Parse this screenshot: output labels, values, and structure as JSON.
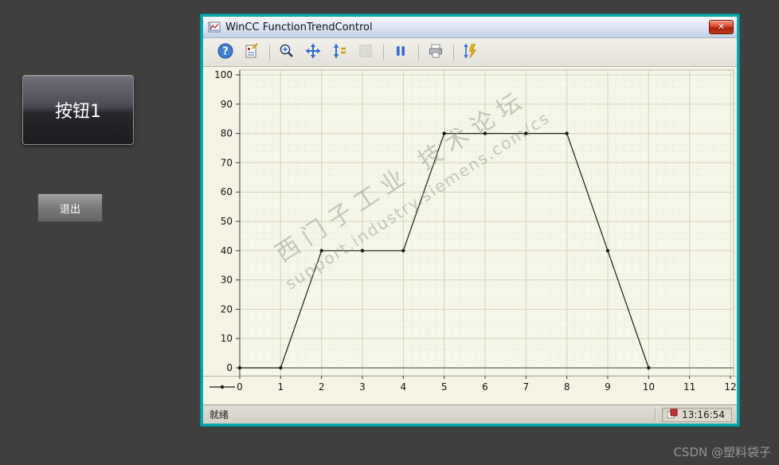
{
  "page": {
    "background": "#3f3f3f",
    "csdn_watermark": "CSDN @塑料袋子"
  },
  "left_panel": {
    "button1_label": "按钮1",
    "exit_label": "退出"
  },
  "window": {
    "title": "WinCC FunctionTrendControl",
    "close_glyph": "✕",
    "border_color": "#00a9ad",
    "close_color": "#c23a1d"
  },
  "toolbar": {
    "icons": [
      "help-icon",
      "report-icon",
      "zoom-icon",
      "move-icon",
      "y-axis-icon",
      "ruler-icon",
      "pause-icon",
      "print-icon",
      "export-icon"
    ]
  },
  "chart_data": {
    "type": "line",
    "title": "",
    "xlabel": "",
    "ylabel": "",
    "x": [
      0,
      1,
      2,
      3,
      4,
      5,
      6,
      7,
      8,
      9,
      10
    ],
    "y": [
      0,
      0,
      40,
      40,
      40,
      80,
      80,
      80,
      80,
      40,
      0
    ],
    "xlim": [
      0,
      12
    ],
    "ylim": [
      0,
      100
    ],
    "x_ticks": [
      0,
      1,
      2,
      3,
      4,
      5,
      6,
      7,
      8,
      9,
      10,
      11,
      12
    ],
    "y_ticks": [
      0,
      10,
      20,
      30,
      40,
      50,
      60,
      70,
      80,
      90,
      100
    ],
    "grid": true,
    "legend_position": "bottom-left",
    "line_color": "#1b1b1b",
    "marker": "circle",
    "plot_bg": "#f7f7e9"
  },
  "watermark": {
    "line1": "西门子工业 技术论坛",
    "line2": "support.industry.siemens.com/cs"
  },
  "statusbar": {
    "ready": "就绪",
    "time": "13:16:54"
  }
}
